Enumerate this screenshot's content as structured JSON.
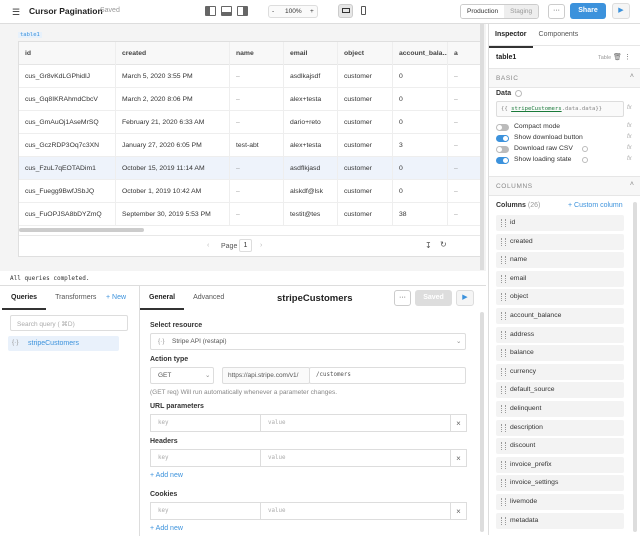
{
  "app": {
    "title": "Cursor Pagination",
    "saved_status": "Saved"
  },
  "toolbar": {
    "zoom": "100%",
    "zoom_minus": "-",
    "zoom_plus": "+",
    "env_production": "Production",
    "env_staging": "Staging",
    "more": "···",
    "share": "Share",
    "play": "▶"
  },
  "table": {
    "tag": "table1",
    "columns": [
      "id",
      "created",
      "name",
      "email",
      "object",
      "account_bala...",
      "a"
    ],
    "rows": [
      [
        "cus_Gr8vKdLGPhidlJ",
        "March 5, 2020 3:55 PM",
        "–",
        "asdlkajsdf",
        "customer",
        "0",
        "–"
      ],
      [
        "cus_Gq8IKRAhmdCbcV",
        "March 2, 2020 8:06 PM",
        "–",
        "alex+testa",
        "customer",
        "0",
        "–"
      ],
      [
        "cus_GmAuOj1AseMrSQ",
        "February 21, 2020 6:33 AM",
        "–",
        "dario+reto",
        "customer",
        "0",
        "–"
      ],
      [
        "cus_GczRDP3Oq7c3XN",
        "January 27, 2020 6:05 PM",
        "test-abt",
        "alex+testa",
        "customer",
        "3",
        "–"
      ],
      [
        "cus_FzuL7qEOTADim1",
        "October 15, 2019 11:14 AM",
        "–",
        "asdflkjasd",
        "customer",
        "0",
        "–"
      ],
      [
        "cus_Fuegg9BwfJSbJQ",
        "October 1, 2019 10:42 AM",
        "–",
        "alskdf@lsk",
        "customer",
        "0",
        "–"
      ],
      [
        "cus_FuOPJSA8bDYZmQ",
        "September 30, 2019 5:53 PM",
        "–",
        "testit@tes",
        "customer",
        "38",
        "–"
      ]
    ],
    "page_label": "Page",
    "page_value": "1"
  },
  "log_message": "All queries completed.",
  "queries": {
    "tab_queries": "Queries",
    "tab_transformers": "Transformers",
    "new": "+ New",
    "search_placeholder": "Search query ( ⌘D)",
    "items": [
      {
        "name": "stripeCustomers"
      }
    ]
  },
  "editor": {
    "tab_general": "General",
    "tab_advanced": "Advanced",
    "query_name": "stripeCustomers",
    "saved_button": "Saved",
    "resource_label": "Select resource",
    "resource_value": "Stripe API (restapi)",
    "action_label": "Action type",
    "method": "GET",
    "base_url": "https://api.stripe.com/v1/",
    "path": "/customers",
    "hint": "(GET req) Will run automatically whenever a parameter changes.",
    "url_params_label": "URL parameters",
    "headers_label": "Headers",
    "cookies_label": "Cookies",
    "key_placeholder": "key",
    "value_placeholder": "value",
    "add_new": "+ Add new"
  },
  "inspector": {
    "tab_inspector": "Inspector",
    "tab_components": "Components",
    "component_name": "table1",
    "component_type": "Table",
    "basic_header": "BASIC",
    "data_label": "Data",
    "data_value_prefix": "{{ ",
    "data_value_code": "stripeCustomers",
    "data_value_suffix": ".data.data}}",
    "options": [
      {
        "label": "Compact mode",
        "on": false
      },
      {
        "label": "Show download button",
        "on": true
      },
      {
        "label": "Download raw CSV",
        "on": false
      },
      {
        "label": "Show loading state",
        "on": true
      }
    ],
    "columns_header": "COLUMNS",
    "columns_label": "Columns",
    "columns_count": "(26)",
    "custom_column": "+ Custom column",
    "column_list": [
      "id",
      "created",
      "name",
      "email",
      "object",
      "account_balance",
      "address",
      "balance",
      "currency",
      "default_source",
      "delinquent",
      "description",
      "discount",
      "invoice_prefix",
      "invoice_settings",
      "livemode",
      "metadata"
    ]
  },
  "colors": {
    "accent": "#3c92dc",
    "selected_row": "#eef3fb"
  }
}
